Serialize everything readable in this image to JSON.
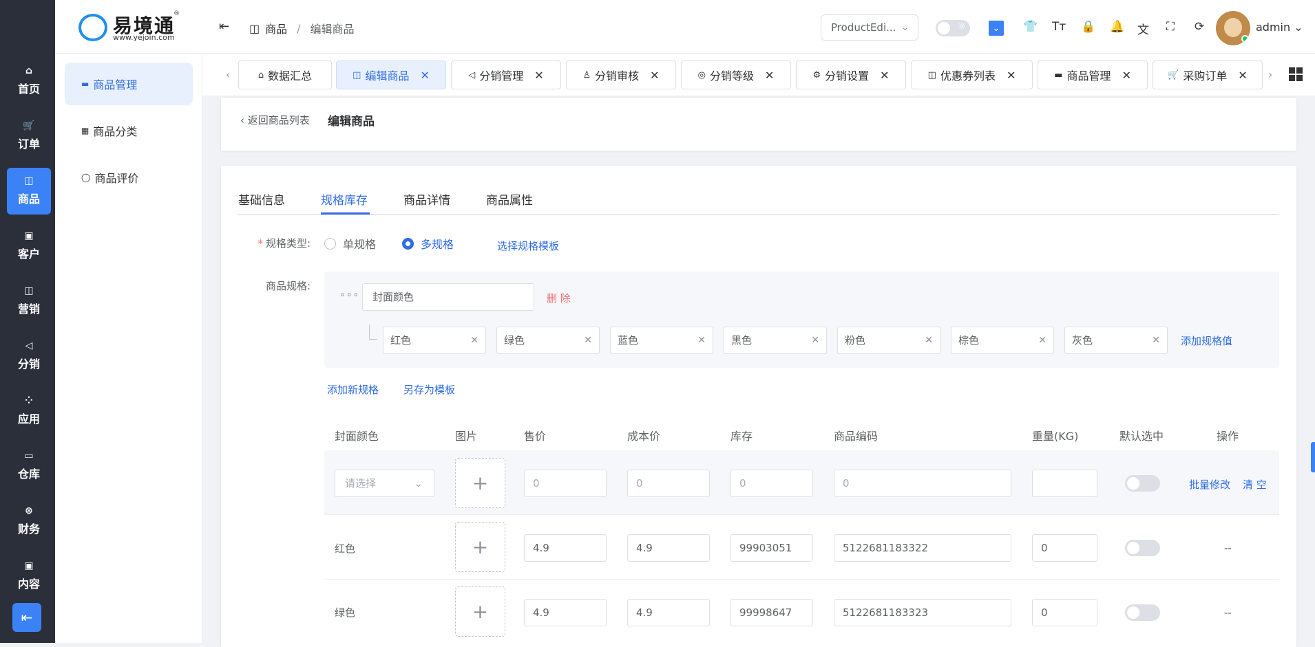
{
  "rail": {
    "items": [
      {
        "icon": "⌂",
        "label": "首页"
      },
      {
        "icon": "🛒",
        "label": "订单"
      },
      {
        "icon": "◫",
        "label": "商品"
      },
      {
        "icon": "▣",
        "label": "客户"
      },
      {
        "icon": "◫",
        "label": "营销"
      },
      {
        "icon": "◁",
        "label": "分销"
      },
      {
        "icon": "⁘",
        "label": "应用"
      },
      {
        "icon": "▭",
        "label": "仓库"
      },
      {
        "icon": "⊛",
        "label": "财务"
      },
      {
        "icon": "▣",
        "label": "内容"
      }
    ],
    "active_index": 2,
    "collapse_icon": "⇤"
  },
  "logo": {
    "name": "易境通",
    "url": "www.yejoin.com",
    "reg": "®"
  },
  "subnav": {
    "items": [
      {
        "icon": "▬",
        "label": "商品管理"
      },
      {
        "icon": "▦",
        "label": "商品分类"
      },
      {
        "icon": "◯",
        "label": "商品评价"
      }
    ]
  },
  "header": {
    "breadcrumb": {
      "root": "商品",
      "sep": "/",
      "current": "编辑商品"
    },
    "version_select": "ProductEdi...",
    "user": "admin",
    "accent": "#3b82f6"
  },
  "tabs": [
    {
      "label": "数据汇总",
      "icon": "⌂",
      "closable": false
    },
    {
      "label": "编辑商品",
      "icon": "◫",
      "closable": true
    },
    {
      "label": "分销管理",
      "icon": "◁",
      "closable": true
    },
    {
      "label": "分销审核",
      "icon": "♙",
      "closable": true
    },
    {
      "label": "分销等级",
      "icon": "◎",
      "closable": true
    },
    {
      "label": "分销设置",
      "icon": "⚙",
      "closable": true
    },
    {
      "label": "优惠券列表",
      "icon": "◫",
      "closable": true
    },
    {
      "label": "商品管理",
      "icon": "▬",
      "closable": true
    },
    {
      "label": "采购订单",
      "icon": "🛒",
      "closable": true
    }
  ],
  "page": {
    "back_label": "返回商品列表",
    "title": "编辑商品"
  },
  "main_tabs": [
    "基础信息",
    "规格库存",
    "商品详情",
    "商品属性"
  ],
  "form": {
    "spec_type_label": "规格类型:",
    "single_spec": "单规格",
    "multi_spec": "多规格",
    "choose_template": "选择规格模板",
    "spec_label": "商品规格:",
    "spec_name": "封面颜色",
    "delete_label": "删 除",
    "values": [
      "红色",
      "绿色",
      "蓝色",
      "黑色",
      "粉色",
      "棕色",
      "灰色"
    ],
    "add_value": "添加规格值",
    "add_spec": "添加新规格",
    "save_template": "另存为模板"
  },
  "table": {
    "headers": [
      "封面颜色",
      "图片",
      "售价",
      "成本价",
      "库存",
      "商品编码",
      "重量(KG)",
      "默认选中",
      "操作"
    ],
    "batch_row": {
      "select_placeholder": "请选择",
      "price": "0",
      "cost": "0",
      "stock": "0",
      "code": "0",
      "weight": "",
      "batch_edit": "批量修改",
      "clear": "清 空"
    },
    "rows": [
      {
        "name": "红色",
        "price": "4.9",
        "cost": "4.9",
        "stock": "99903051",
        "code": "5122681183322",
        "weight": "0",
        "action": "--"
      },
      {
        "name": "绿色",
        "price": "4.9",
        "cost": "4.9",
        "stock": "99998647",
        "code": "5122681183323",
        "weight": "0",
        "action": "--"
      }
    ]
  }
}
